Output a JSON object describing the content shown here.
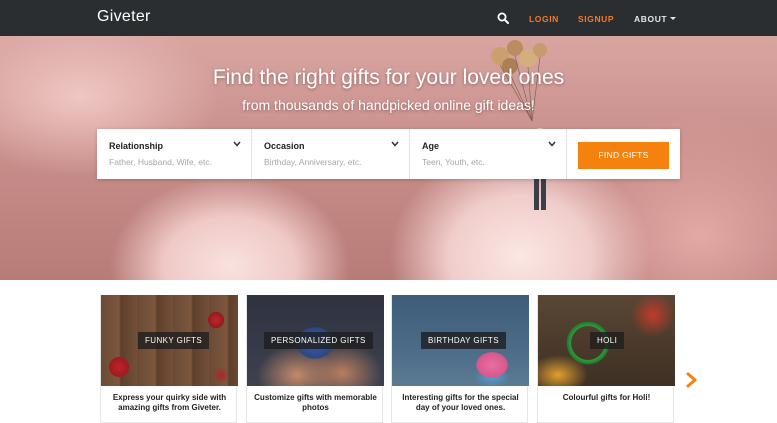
{
  "navbar": {
    "brand": "Giveter",
    "search_icon": "search-icon",
    "login": "LOGIN",
    "signup": "SIGNUP",
    "about": "ABOUT",
    "accent_color": "#f27a29",
    "background_color": "#2b2e31"
  },
  "hero": {
    "title": "Find the right gifts for your loved ones",
    "subtitle": "from thousands of handpicked online gift ideas!"
  },
  "search": {
    "filters": [
      {
        "label": "Relationship",
        "hint": "Father, Husband, Wife, etc."
      },
      {
        "label": "Occasion",
        "hint": "Birthday, Anniversary, etc."
      },
      {
        "label": "Age",
        "hint": "Teen, Youth, etc."
      }
    ],
    "button": "FIND GIFTS",
    "button_color": "#f5820f"
  },
  "categories": [
    {
      "tag": "FUNKY GIFTS",
      "description": "Express your quirky side with amazing gifts from Giveter."
    },
    {
      "tag": "PERSONALIZED GIFTS",
      "description": "Customize gifts with memorable photos"
    },
    {
      "tag": "BIRTHDAY GIFTS",
      "description": "Interesting gifts for the special day of your loved ones."
    },
    {
      "tag": "HOLI",
      "description": "Colourful gifts for Holi!"
    }
  ],
  "carousel": {
    "next_icon": "chevron-right-icon",
    "arrow_color": "#f5820f"
  }
}
